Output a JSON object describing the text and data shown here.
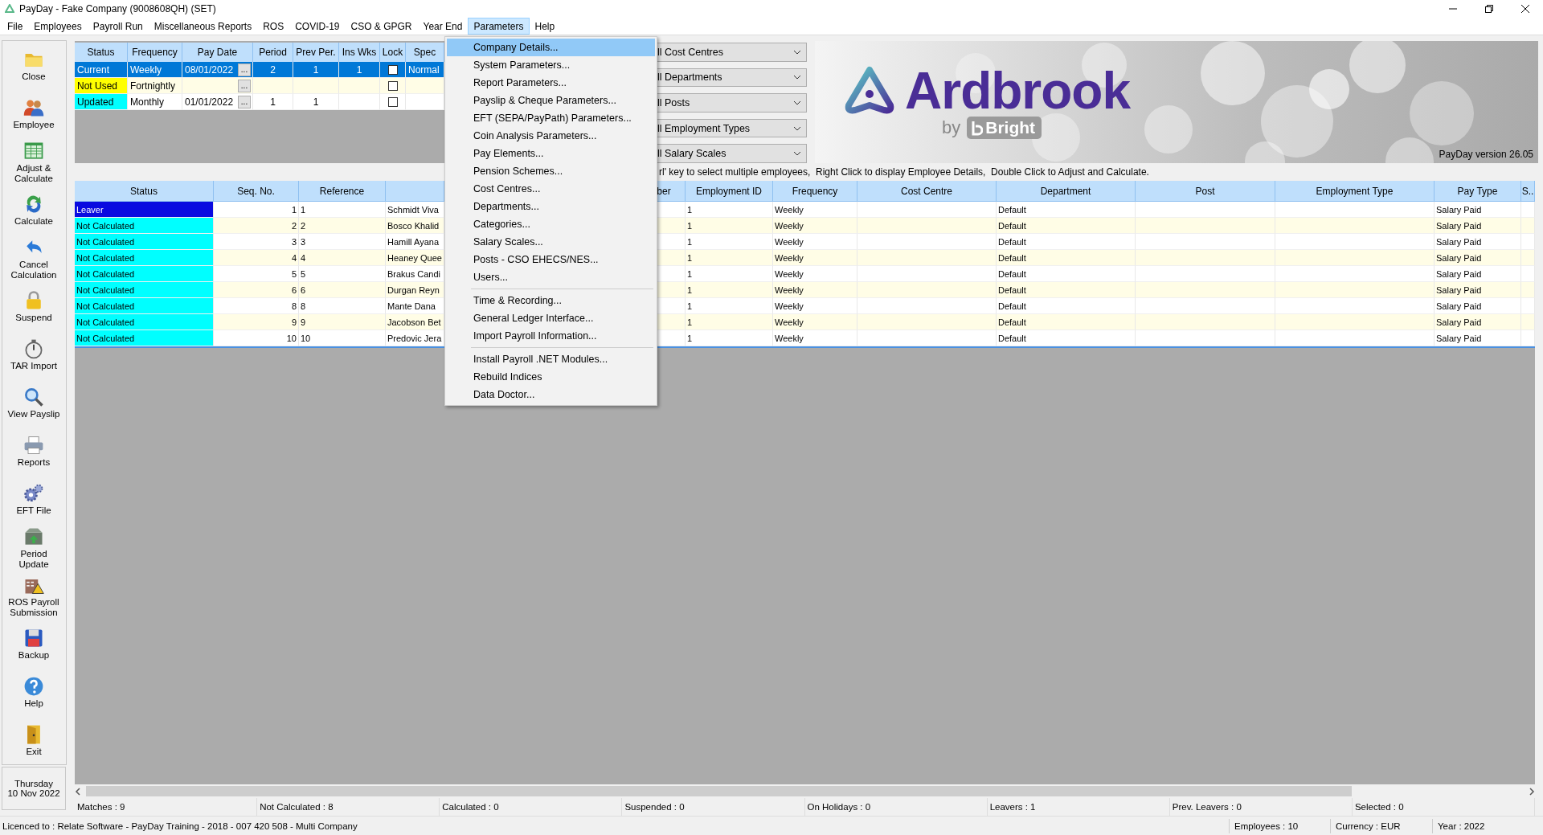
{
  "window": {
    "title": "PayDay - Fake Company (9008608QH) (SET)"
  },
  "menu_bar": [
    {
      "label": "File",
      "selected": false
    },
    {
      "label": "Employees",
      "selected": false
    },
    {
      "label": "Payroll Run",
      "selected": false
    },
    {
      "label": "Miscellaneous Reports",
      "selected": false
    },
    {
      "label": "ROS",
      "selected": false
    },
    {
      "label": "COVID-19",
      "selected": false
    },
    {
      "label": "CSO & GPGR",
      "selected": false
    },
    {
      "label": "Year End",
      "selected": false
    },
    {
      "label": "Parameters",
      "selected": true
    },
    {
      "label": "Help",
      "selected": false
    }
  ],
  "parameters_menu": {
    "sections": [
      {
        "items": [
          {
            "label": "Company Details...",
            "selected": true
          },
          {
            "label": "System Parameters...",
            "selected": false
          },
          {
            "label": "Report Parameters...",
            "selected": false
          },
          {
            "label": "Payslip & Cheque Parameters...",
            "selected": false
          },
          {
            "label": "EFT (SEPA/PayPath) Parameters...",
            "selected": false
          },
          {
            "label": "Coin Analysis Parameters...",
            "selected": false
          },
          {
            "label": "Pay Elements...",
            "selected": false
          },
          {
            "label": "Pension Schemes...",
            "selected": false
          },
          {
            "label": "Cost Centres...",
            "selected": false
          },
          {
            "label": "Departments...",
            "selected": false
          },
          {
            "label": "Categories...",
            "selected": false
          },
          {
            "label": "Salary Scales...",
            "selected": false
          },
          {
            "label": "Posts - CSO EHECS/NES...",
            "selected": false
          },
          {
            "label": "Users...",
            "selected": false
          }
        ]
      },
      {
        "items": [
          {
            "label": "Time & Recording...",
            "selected": false
          },
          {
            "label": "General Ledger Interface...",
            "selected": false
          },
          {
            "label": "Import Payroll Information...",
            "selected": false
          }
        ]
      },
      {
        "items": [
          {
            "label": "Install Payroll .NET Modules...",
            "selected": false
          },
          {
            "label": "Rebuild Indices",
            "selected": false
          },
          {
            "label": "Data Doctor...",
            "selected": false
          }
        ]
      }
    ]
  },
  "sidebar": {
    "buttons": [
      {
        "label": "Close",
        "kind": "folder"
      },
      {
        "label": "Employee",
        "kind": "people"
      },
      {
        "label": "Adjust & Calculate",
        "kind": "sheet"
      },
      {
        "label": "Calculate",
        "kind": "calculate"
      },
      {
        "label": "Cancel Calculation",
        "kind": "undo"
      },
      {
        "label": "Suspend",
        "kind": "lock"
      },
      {
        "label": "TAR Import",
        "kind": "stopwatch"
      },
      {
        "label": "View Payslip",
        "kind": "magnifier"
      },
      {
        "label": "Reports",
        "kind": "printer"
      },
      {
        "label": "EFT File",
        "kind": "gears"
      },
      {
        "label": "Period Update",
        "kind": "box"
      },
      {
        "label": "ROS Payroll Submission",
        "kind": "warning"
      },
      {
        "label": "Backup",
        "kind": "disk"
      },
      {
        "label": "Help",
        "kind": "help"
      },
      {
        "label": "Exit",
        "kind": "door"
      }
    ],
    "day": "Thursday",
    "date": "10 Nov 2022"
  },
  "pay_frequencies": {
    "columns": [
      "Status",
      "Frequency",
      "Pay Date",
      "Period",
      "Prev Per.",
      "Ins Wks",
      "Lock",
      "Spec"
    ],
    "rows": [
      {
        "status": "Current",
        "color": "#0078d7",
        "selected": true,
        "frequency": "Weekly",
        "pay_date": "08/01/2022",
        "date_button": "...",
        "period": "2",
        "prev_period": "1",
        "ins_wks": "1",
        "locked": false,
        "spec": "Normal"
      },
      {
        "status": "Not Used",
        "color": "#ffff00",
        "selected": false,
        "frequency": "Fortnightly",
        "date_button": "...",
        "locked": false
      },
      {
        "status": "Updated",
        "color": "#00ffff",
        "selected": false,
        "frequency": "Monthly",
        "pay_date": "01/01/2022",
        "date_button": "...",
        "period": "1",
        "prev_period": "1",
        "locked": false
      }
    ]
  },
  "filters": [
    {
      "value": "ll Cost Centres"
    },
    {
      "value": "ll Departments"
    },
    {
      "value": "ll Posts"
    },
    {
      "value": "ll Employment Types"
    },
    {
      "value": "ll Salary Scales"
    }
  ],
  "banner": {
    "brand": "Ardbrook",
    "by": "by",
    "partner": "Bright",
    "version": "PayDay version 26.05"
  },
  "hint": "rl' key to select multiple employees,  Right Click to display Employee Details,  Double Click to Adjust and Calculate.",
  "employees": {
    "columns": [
      "Status",
      "Seq. No.",
      "Reference",
      "ber",
      "Employment ID",
      "Frequency",
      "Cost Centre",
      "Department",
      "Post",
      "Employment Type",
      "Pay Type",
      "S.."
    ],
    "rows": [
      {
        "status": "Leaver",
        "color": "#0a0ae0",
        "seq_no": "1",
        "reference": "1",
        "name": "Schmidt Viva",
        "employment_id": "1",
        "frequency": "Weekly",
        "department": "Default",
        "pay_type": "Salary Paid"
      },
      {
        "status": "Not Calculated",
        "color": "#00ffff",
        "seq_no": "2",
        "reference": "2",
        "name": "Bosco Khalid",
        "employment_id": "1",
        "frequency": "Weekly",
        "department": "Default",
        "pay_type": "Salary Paid"
      },
      {
        "status": "Not Calculated",
        "color": "#00ffff",
        "seq_no": "3",
        "reference": "3",
        "name": "Hamill Ayana",
        "employment_id": "1",
        "frequency": "Weekly",
        "department": "Default",
        "pay_type": "Salary Paid"
      },
      {
        "status": "Not Calculated",
        "color": "#00ffff",
        "seq_no": "4",
        "reference": "4",
        "name": "Heaney Quee",
        "employment_id": "1",
        "frequency": "Weekly",
        "department": "Default",
        "pay_type": "Salary Paid"
      },
      {
        "status": "Not Calculated",
        "color": "#00ffff",
        "seq_no": "5",
        "reference": "5",
        "name": "Brakus Candi",
        "employment_id": "1",
        "frequency": "Weekly",
        "department": "Default",
        "pay_type": "Salary Paid"
      },
      {
        "status": "Not Calculated",
        "color": "#00ffff",
        "seq_no": "6",
        "reference": "6",
        "name": "Durgan Reyn",
        "employment_id": "1",
        "frequency": "Weekly",
        "department": "Default",
        "pay_type": "Salary Paid"
      },
      {
        "status": "Not Calculated",
        "color": "#00ffff",
        "seq_no": "8",
        "reference": "8",
        "name": "Mante Dana",
        "employment_id": "1",
        "frequency": "Weekly",
        "department": "Default",
        "pay_type": "Salary Paid"
      },
      {
        "status": "Not Calculated",
        "color": "#00ffff",
        "seq_no": "9",
        "reference": "9",
        "name": "Jacobson Bet",
        "employment_id": "1",
        "frequency": "Weekly",
        "department": "Default",
        "pay_type": "Salary Paid"
      },
      {
        "status": "Not Calculated",
        "color": "#00ffff",
        "seq_no": "10",
        "reference": "10",
        "name": "Predovic Jera",
        "employment_id": "1",
        "frequency": "Weekly",
        "department": "Default",
        "pay_type": "Salary Paid"
      }
    ]
  },
  "summary": [
    "Matches : 9",
    "Not Calculated : 8",
    "Calculated : 0",
    "Suspended : 0",
    "On Holidays : 0",
    "Leavers : 1",
    "Prev. Leavers : 0",
    "Selected : 0"
  ],
  "status_bar": {
    "licence": "Licenced to : Relate Software - PayDay Training - 2018 - 007 420 508 - Multi Company",
    "employees": "Employees : 10",
    "currency": "Currency : EUR",
    "year": "Year : 2022"
  }
}
